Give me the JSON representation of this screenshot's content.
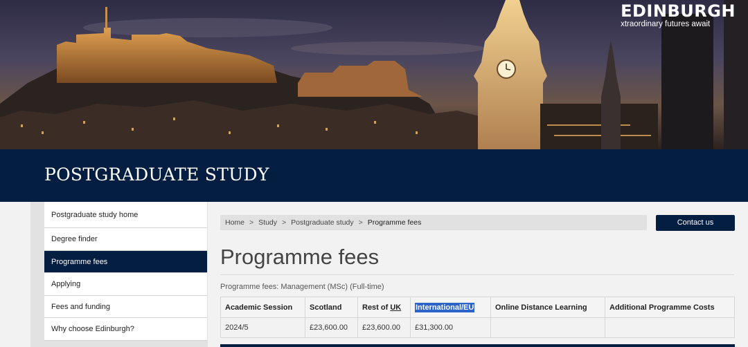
{
  "brand": {
    "name": "EDINBURGH",
    "tagline": "xtraordinary futures await"
  },
  "banner": {
    "title": "POSTGRADUATE STUDY"
  },
  "sidebar": {
    "items": [
      {
        "label": "Postgraduate study home"
      },
      {
        "label": "Degree finder"
      },
      {
        "label": "Programme fees",
        "active": true
      },
      {
        "label": "Applying"
      },
      {
        "label": "Fees and funding"
      },
      {
        "label": "Why choose Edinburgh?"
      }
    ]
  },
  "breadcrumb": {
    "home": "Home",
    "study": "Study",
    "postgrad": "Postgraduate study",
    "current": "Programme fees",
    "separator": ">"
  },
  "contact": {
    "label": "Contact us"
  },
  "page": {
    "title": "Programme fees",
    "subtitle": "Programme fees: Management (MSc) (Full-time)"
  },
  "table": {
    "headers": {
      "session": "Academic Session",
      "scotland": "Scotland",
      "rest_of": "Rest of ",
      "uk": "UK",
      "international": "International/EU",
      "online": "Online Distance Learning",
      "additional": "Additional Programme Costs"
    },
    "rows": [
      {
        "session": "2024/5",
        "scotland": "£23,600.00",
        "rest_uk": "£23,600.00",
        "international": "£31,300.00",
        "online": "",
        "additional": ""
      }
    ]
  },
  "colors": {
    "navy": "#041e42",
    "highlight": "#2b63c8"
  }
}
